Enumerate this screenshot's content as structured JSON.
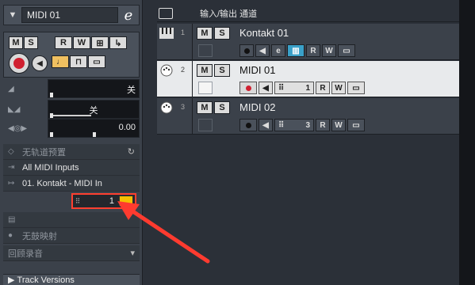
{
  "inspector": {
    "track_title": "MIDI 01",
    "mute": "M",
    "solo": "S",
    "read": "R",
    "write": "W",
    "volume_value": "关",
    "pan_value": "关",
    "delay_value": "0.00",
    "preset_label": "无轨道预置",
    "input_label": "All MIDI Inputs",
    "output_label": "01. Kontakt - MIDI In",
    "channel_value": "1",
    "map_label": "无鼓映射",
    "record_label": "回顾录音",
    "track_versions_label": "Track Versions"
  },
  "tracklist": {
    "header_title": "输入/输出 通道",
    "tracks": [
      {
        "number": "1",
        "name": "Kontakt 01",
        "channel": ""
      },
      {
        "number": "2",
        "name": "MIDI 01",
        "channel": "1"
      },
      {
        "number": "3",
        "name": "MIDI 02",
        "channel": "3"
      }
    ]
  },
  "colors": {
    "accent_red": "#ff4030",
    "record_red": "#d02030",
    "highlight_yellow": "#f5c000",
    "active_blue": "#3aa0c8"
  }
}
